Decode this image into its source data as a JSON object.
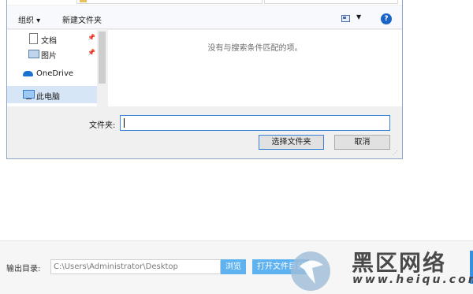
{
  "dialog": {
    "toolbar": {
      "organize": "组织 ▾",
      "new_folder": "新建文件夹"
    },
    "nav": [
      {
        "label": "文档",
        "icon": "document-icon",
        "pinned": true
      },
      {
        "label": "图片",
        "icon": "pictures-icon",
        "pinned": true
      },
      {
        "label": "OneDrive",
        "icon": "onedrive-cloud-icon",
        "pinned": false
      },
      {
        "label": "此电脑",
        "icon": "this-pc-icon",
        "pinned": false
      }
    ],
    "empty_message": "没有与搜索条件匹配的项。",
    "folder_label": "文件夹:",
    "folder_value": "",
    "select_button": "选择文件夹",
    "cancel_button": "取消",
    "help_icon": "?"
  },
  "bottom": {
    "output_label": "输出目录:",
    "output_path": "C:\\Users\\Administrator\\Desktop",
    "browse": "浏览",
    "open_folder": "打开文件目录"
  },
  "watermark": {
    "title": "黑区网络",
    "url": "www.heiqu.com"
  },
  "colors": {
    "accent": "#3b83d8",
    "button_blue": "#5fb2f0",
    "selection": "#d7e6f7"
  }
}
